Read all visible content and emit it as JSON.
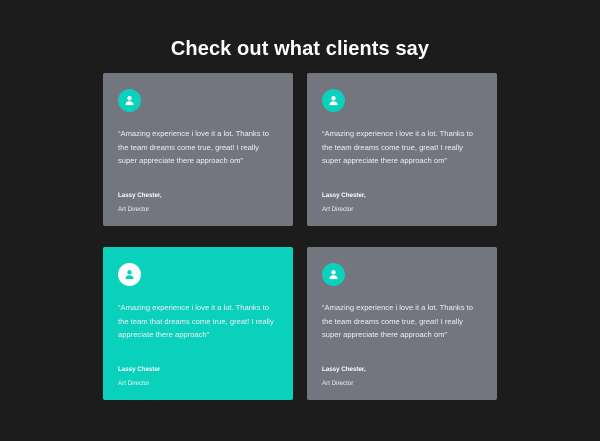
{
  "section": {
    "title": "Check out what clients say"
  },
  "colors": {
    "background": "#1c1c1d",
    "card": "#73767e",
    "accent": "#0ad1bb"
  },
  "testimonials": [
    {
      "icon": "user-icon",
      "quote": "“Amazing experience i love it a lot. Thanks to the team dreams come true, great! I really super appreciate there approach om”",
      "name": "Lassy Chester,",
      "role": "Art Director"
    },
    {
      "icon": "user-icon",
      "quote": "“Amazing experience i love it a lot. Thanks to the team dreams come true, great! I really super appreciate there approach om”",
      "name": "Lassy Chester,",
      "role": "Art Director"
    },
    {
      "icon": "user-icon",
      "quote": "“Amazing experience i love it a lot. Thanks to the team that dreams come true, great! I really appreciate there approach”",
      "name": "Lassy Chester",
      "role": "Art Director",
      "featured": true
    },
    {
      "icon": "user-icon",
      "quote": "“Amazing experience i love it a lot. Thanks to the team dreams come true, great! I really super appreciate there approach om”",
      "name": "Lassy Chester,",
      "role": "Art Director"
    }
  ]
}
